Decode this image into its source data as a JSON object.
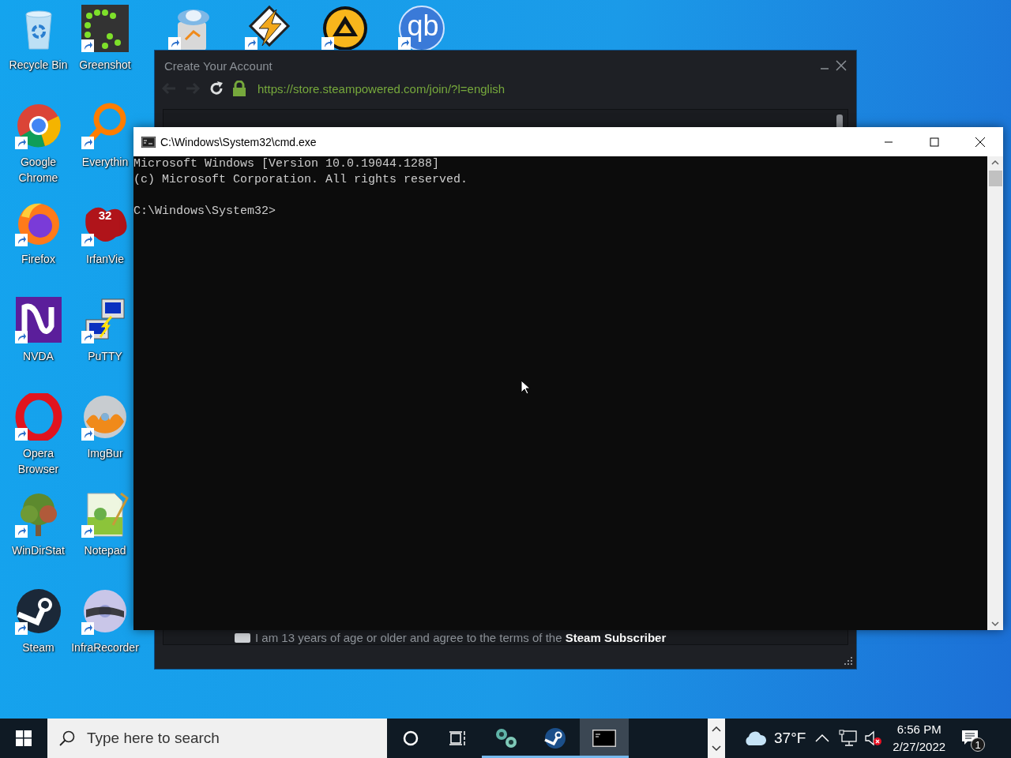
{
  "desktop": {
    "columns": [
      [
        {
          "label": "Recycle Bin",
          "shortcut": false
        },
        {
          "label": "Google Chrome",
          "shortcut": true
        },
        {
          "label": "Firefox",
          "shortcut": true
        },
        {
          "label": "NVDA",
          "shortcut": true
        },
        {
          "label": "Opera Browser",
          "shortcut": true
        },
        {
          "label": "WinDirStat",
          "shortcut": true
        },
        {
          "label": "Steam",
          "shortcut": true
        }
      ],
      [
        {
          "label": "Greenshot",
          "shortcut": true
        },
        {
          "label": "Everythin",
          "shortcut": true
        },
        {
          "label": "IrfanVie",
          "shortcut": true,
          "logo_text": "32"
        },
        {
          "label": "PuTTY",
          "shortcut": true
        },
        {
          "label": "ImgBur",
          "shortcut": true
        },
        {
          "label": "Notepad",
          "shortcut": true
        },
        {
          "label": "InfraRecorder",
          "shortcut": true
        }
      ],
      [
        {
          "shortcut": true
        }
      ],
      [
        {
          "shortcut": true
        }
      ],
      [
        {
          "shortcut": true
        }
      ],
      [
        {
          "shortcut": true,
          "logo_text": "qb"
        }
      ]
    ]
  },
  "steam_window": {
    "title": "Create Your Account",
    "url": "https://store.steampowered.com/join/?l=english",
    "secure": true,
    "back_disabled": true,
    "forward_disabled": true,
    "agreement": {
      "text": "I am 13 years of age or older and agree to the terms of the **Steam Subscriber**",
      "checked": false
    }
  },
  "cmd_window": {
    "title": "C:\\Windows\\System32\\cmd.exe",
    "lines": [
      "Microsoft Windows [Version 10.0.19044.1288]",
      "(c) Microsoft Corporation. All rights reserved."
    ],
    "prompt": "C:\\Windows\\System32>"
  },
  "taskbar": {
    "search": {
      "placeholder": "Type here to search"
    },
    "apps": [
      {
        "kind": "spheres",
        "running": true,
        "selected": false
      },
      {
        "kind": "steam",
        "running": true,
        "selected": false
      },
      {
        "kind": "terminal",
        "running": true,
        "selected": true
      }
    ],
    "weather": {
      "temperature": "37°F"
    },
    "volume": {
      "muted": true
    },
    "clock": {
      "time": "6:56 PM",
      "date": "2/27/2022"
    },
    "notifications": {
      "count": "1"
    }
  }
}
